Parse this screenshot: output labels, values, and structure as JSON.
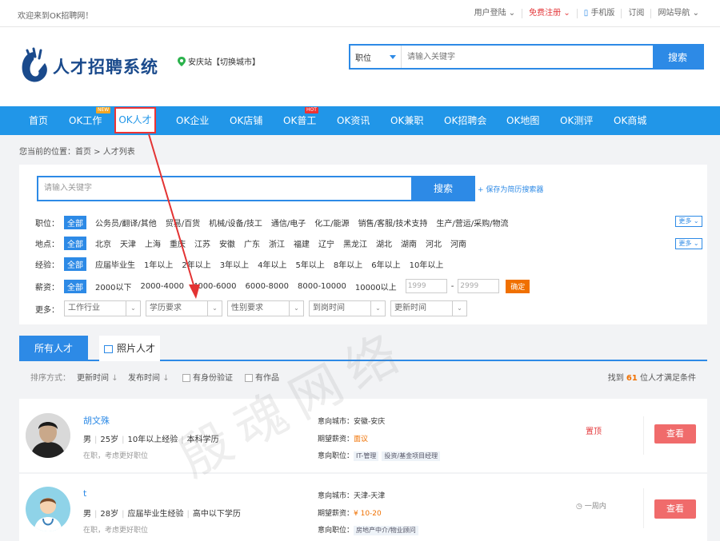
{
  "topbar": {
    "welcome": "欢迎来到OK招聘网！",
    "links": [
      "用户登陆",
      "免费注册",
      "手机版",
      "订阅",
      "网站导航"
    ]
  },
  "header": {
    "logo_text": "人才招聘系统",
    "city": "安庆站【切换城市】",
    "search_select": "职位",
    "search_placeholder": "请输入关键字",
    "search_button": "搜索"
  },
  "nav": {
    "items": [
      "首页",
      "OK工作",
      "OK人才",
      "OK企业",
      "OK店铺",
      "OK普工",
      "OK资讯",
      "OK兼职",
      "OK招聘会",
      "OK地图",
      "OK测评",
      "OK商城"
    ],
    "badge_new": "NEW",
    "badge_hot": "HOT"
  },
  "breadcrumb": "您当前的位置：首页 > 人才列表",
  "filter": {
    "search_placeholder": "请输入关键字",
    "search_button": "搜索",
    "save_link": "+ 保存为简历搜索器",
    "job_label": "职位：",
    "jobs": [
      "全部",
      "公务员/翻译/其他",
      "贸易/百货",
      "机械/设备/技工",
      "通信/电子",
      "化工/能源",
      "销售/客服/技术支持",
      "生产/营运/采购/物流"
    ],
    "area_label": "地点：",
    "areas": [
      "全部",
      "北京",
      "天津",
      "上海",
      "重庆",
      "江苏",
      "安徽",
      "广东",
      "浙江",
      "福建",
      "辽宁",
      "黑龙江",
      "湖北",
      "湖南",
      "河北",
      "河南"
    ],
    "exp_label": "经验：",
    "exps": [
      "全部",
      "应届毕业生",
      "1年以上",
      "2年以上",
      "3年以上",
      "4年以上",
      "5年以上",
      "8年以上",
      "6年以上",
      "10年以上"
    ],
    "salary_label": "薪资：",
    "salaries": [
      "全部",
      "2000以下",
      "2000-4000",
      "4000-6000",
      "6000-8000",
      "8000-10000",
      "10000以上"
    ],
    "salary_min": "1999",
    "salary_max": "2999",
    "salary_dash": "-",
    "confirm": "确定",
    "more_label": "更多：",
    "dropdowns": [
      "工作行业",
      "学历要求",
      "性别要求",
      "到岗时间",
      "更新时间"
    ],
    "more_btn": "更多"
  },
  "tabs": [
    "所有人才",
    "照片人才"
  ],
  "sortbar": {
    "label": "排序方式：",
    "sort1": "更新时间",
    "sort2": "发布时间",
    "check1": "有身份验证",
    "check2": "有作品",
    "found_pre": "找到",
    "found_count": "61",
    "found_post": "位人才满足条件"
  },
  "cards": [
    {
      "name": "胡文殊",
      "gender": "男",
      "age": "25岁",
      "exp": "10年以上经验",
      "edu": "本科学历",
      "status": "在职，考虑更好职位",
      "city_label": "意向城市：",
      "city": "安徽-安庆",
      "salary_label": "期望薪资：",
      "salary": "面议",
      "pos_label": "意向职位：",
      "tags": [
        "IT-管理",
        "投资/基金项目经理"
      ],
      "flag": "置顶",
      "view": "查看"
    },
    {
      "name": "t",
      "gender": "男",
      "age": "28岁",
      "exp": "应届毕业生经验",
      "edu": "高中以下学历",
      "status": "在职，考虑更好职位",
      "city_label": "意向城市：",
      "city": "天津-天津",
      "salary_label": "期望薪资：",
      "salary": "¥ 10-20",
      "pos_label": "意向职位：",
      "tags": [
        "房地产中介/物业顾问"
      ],
      "time": "一周内",
      "view": "查看"
    }
  ],
  "watermark": "殷魂网络",
  "colors": {
    "primary": "#2d8ae6",
    "nav": "#2196e8",
    "accent": "#f07000",
    "view": "#f06b6b",
    "annotation": "#e33333"
  }
}
